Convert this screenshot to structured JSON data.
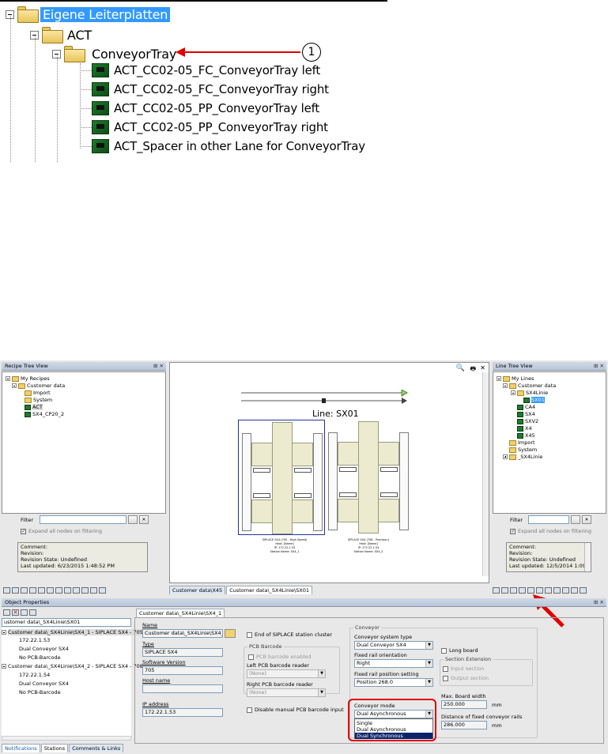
{
  "top_tree": {
    "root_label": "Eigene Leiterplatten",
    "act_label": "ACT",
    "conveyor_label": "ConveyorTray",
    "callout_number": "1",
    "boards": [
      "ACT_CC02-05_FC_ConveyorTray left",
      "ACT_CC02-05_FC_ConveyorTray right",
      "ACT_CC02-05_PP_ConveyorTray left",
      "ACT_CC02-05_PP_ConveyorTray right",
      "ACT_Spacer in other Lane for ConveyorTray"
    ]
  },
  "recipe_tree": {
    "title": "Recipe Tree View",
    "items": [
      "My Recipes",
      "Customer data",
      "Import",
      "System",
      "ACT",
      "SX4_CP20_2"
    ],
    "filter_label": "Filter",
    "expand_label": "Expand all nodes on filtering",
    "comment_label": "Comment:",
    "revision_label": "Revision:",
    "revision_state": "Revision State: Undefined",
    "last_updated": "Last updated: 6/23/2015 1:48:52 PM"
  },
  "line_tree": {
    "title": "Line Tree View",
    "items": [
      "My Lines",
      "Customer data",
      "SX4Linie",
      "SX01",
      "CA4",
      "SX4",
      "SXV2",
      "X4",
      "X45",
      "Import",
      "System",
      "_SX4Linie"
    ],
    "filter_label": "Filter",
    "expand_label": "Expand all nodes on filtering",
    "comment_label": "Comment:",
    "revision_label": "Revision:",
    "revision_state": "Revision State: Undefined",
    "last_updated": "Last updated: 12/5/2014 1:09:21"
  },
  "diagram": {
    "line_title": "Line: SX01",
    "station1_caption": [
      "SIPLACE SX4 (705 - High Speed)",
      "Host: [Name]",
      "IP: 172.22.1.53",
      "Station Name: SX4_1"
    ],
    "station2_caption": [
      "SIPLACE SX4 (708 - Precision)",
      "Host: [Name]",
      "IP: 172.22.1.54",
      "Station Name: SX4_2"
    ]
  },
  "doc_tabs": [
    "Customer data\\X45",
    "Customer data\\_SX4Linie\\SX01"
  ],
  "object_properties": {
    "title": "Object Properties",
    "path_value": "ustomer data\\_SX4Linie\\SX01",
    "tree": [
      "Customer data\\_SX4Linie\\SX4_1 - SIPLACE SX4 - 705",
      "172.22.1.53",
      "Dual Conveyor SX4",
      "No PCB-Barcode",
      "Customer data\\_SX4Linie\\SX4_2 - SIPLACE SX4 - 708",
      "172.22.1.54",
      "Dual Conveyor SX4",
      "No PCB-Barcode"
    ],
    "bottom_tabs": [
      "Notifications",
      "Stations",
      "Comments & Links"
    ],
    "form_tab": "Customer data\\_SX4Linie\\SX4_1",
    "name_label": "Name",
    "name_value": "Customer data\\_SX4Linie\\SX4_1",
    "type_label": "Type",
    "type_value": "SIPLACE SX4",
    "sw_label": "Software Version",
    "sw_value": "705",
    "host_label": "Host name",
    "host_value": "",
    "ip_label": "IP address",
    "ip_value": "172.22.1.53",
    "end_cluster": "End of SIPLACE station cluster",
    "pcb_barcode_group": "PCB Barcode",
    "pcb_barcode_enabled": "PCB barcode enabled",
    "left_reader_label": "Left PCB barcode reader",
    "left_reader_value": "(None)",
    "right_reader_label": "Right PCB barcode reader",
    "right_reader_value": "(None)",
    "disable_manual": "Disable manual PCB barcode input",
    "conveyor_group": "Conveyor",
    "conveyor_type_label": "Conveyor system type",
    "conveyor_type_value": "Dual Conveyor SX4",
    "fixed_rail_label": "Fixed rail orientation",
    "fixed_rail_value": "Right",
    "fixed_pos_label": "Fixed rail position setting",
    "fixed_pos_value": "Position 268.0",
    "mode_label": "Conveyor mode",
    "mode_value": "Dual Asynchronous",
    "mode_options": [
      "Single",
      "Dual Asynchronous",
      "Dual Synchronous"
    ],
    "long_board": "Long board",
    "section_ext": "Section Extension",
    "input_section": "Input section",
    "output_section": "Output section",
    "max_width_label": "Max. Board width",
    "max_width_value": "250.000",
    "unit_mm": "mm",
    "distance_label": "Distance of fixed conveyor rails",
    "distance_value": "286.000"
  },
  "colors": {
    "highlight_blue": "#3399ff",
    "callout_red": "#e00000",
    "panel_title": "#c4cfdf"
  }
}
